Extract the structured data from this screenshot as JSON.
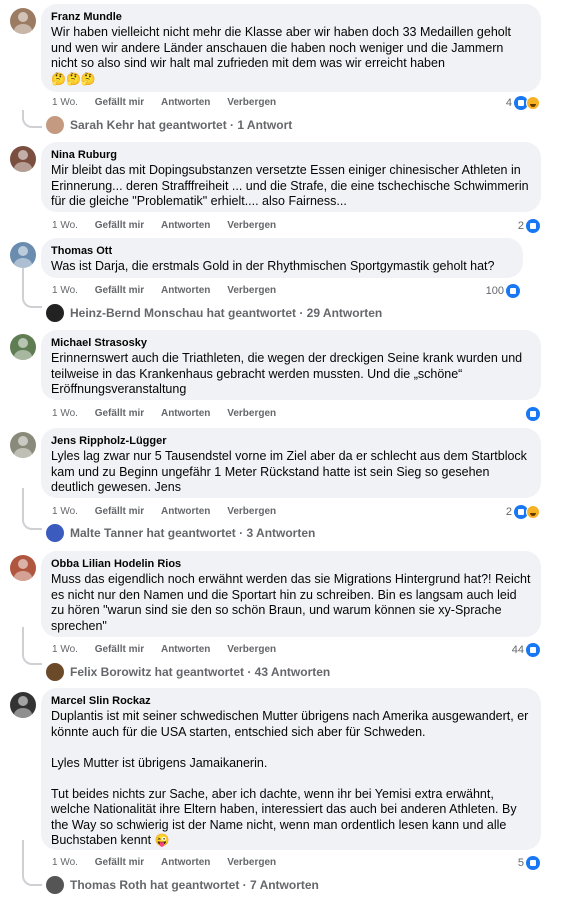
{
  "labels": {
    "like": "Gefällt mir",
    "reply": "Antworten",
    "hide": "Verbergen"
  },
  "comments": [
    {
      "author": "Franz Mundle",
      "text": "Wir haben vielleicht nicht mehr die Klasse aber wir haben doch 33 Medaillen geholt und wen wir andere Länder anschauen die haben noch weniger und die Jammern nicht so also sind wir halt mal zufrieden mit dem was wir erreicht haben",
      "emoji": "🤔🤔🤔",
      "time": "1 Wo.",
      "reactions": "4",
      "replies": "Sarah Kehr hat geantwortet · 1 Antwort"
    },
    {
      "author": "Nina Ruburg",
      "text": "Mir bleibt das mit Dopingsubstanzen versetzte Essen einiger chinesischer Athleten in Erinnerung... deren Strafffreiheit ... und die Strafe, die eine tschechische Schwimmerin für die gleiche \"Problematik\" erhielt.... also Fairness...",
      "time": "1 Wo.",
      "reactions": "2"
    },
    {
      "author": "Thomas Ott",
      "text": "Was ist Darja, die erstmals Gold in der Rhythmischen Sportgymastik geholt hat?",
      "time": "1 Wo.",
      "reactions": "100",
      "replies": "Heinz-Bernd Monschau hat geantwortet · 29 Antworten"
    },
    {
      "author": "Michael Strasosky",
      "text": "Erinnernswert auch die Triathleten, die wegen der dreckigen Seine krank wurden und teilweise in das Krankenhaus gebracht werden mussten. Und die „schöne“ Eröffnungsveranstaltung",
      "time": "1 Wo.",
      "reactions": ""
    },
    {
      "author": "Jens Rippholz-Lügger",
      "text": "Lyles lag zwar nur 5 Tausendstel vorne im Ziel aber da er schlecht aus dem Startblock kam und zu Beginn ungefähr 1 Meter Rückstand hatte ist sein Sieg so gesehen deutlich gewesen. Jens",
      "time": "1 Wo.",
      "reactions": "2",
      "replies": "Malte Tanner hat geantwortet · 3 Antworten"
    },
    {
      "author": "Obba Lilian Hodelin Rios",
      "text": "Muss das eigendlich noch erwähnt werden das sie Migrations Hintergrund hat?! Reicht es nicht nur den Namen und die Sportart hin zu schreiben. Bin es langsam auch leid zu hören \"warun sind sie den so schön Braun, und warum können sie xy-Sprache sprechen\"",
      "time": "1 Wo.",
      "reactions": "44",
      "replies": "Felix Borowitz hat geantwortet · 43 Antworten"
    },
    {
      "author": "Marcel Slin Rockaz",
      "text": "Duplantis ist mit seiner schwedischen Mutter übrigens nach Amerika ausgewandert, er könnte auch für die USA starten, entschied sich aber für Schweden.\n\nLyles Mutter ist übrigens Jamaikanerin.\n\nTut beides nichts zur Sache, aber ich dachte, wenn ihr bei Yemisi extra erwähnt, welche Nationalität ihre Eltern haben, interessiert das auch bei anderen Athleten. By the Way so schwierig ist der Name nicht, wenn man ordentlich lesen kann und alle Buchstaben kennt",
      "emoji": "😜",
      "time": "1 Wo.",
      "reactions": "5",
      "replies": "Thomas Roth hat geantwortet · 7 Antworten"
    }
  ],
  "colors": {
    "bubble": "#f0f2f5",
    "meta": "#65676b",
    "like": "#1877f2"
  }
}
